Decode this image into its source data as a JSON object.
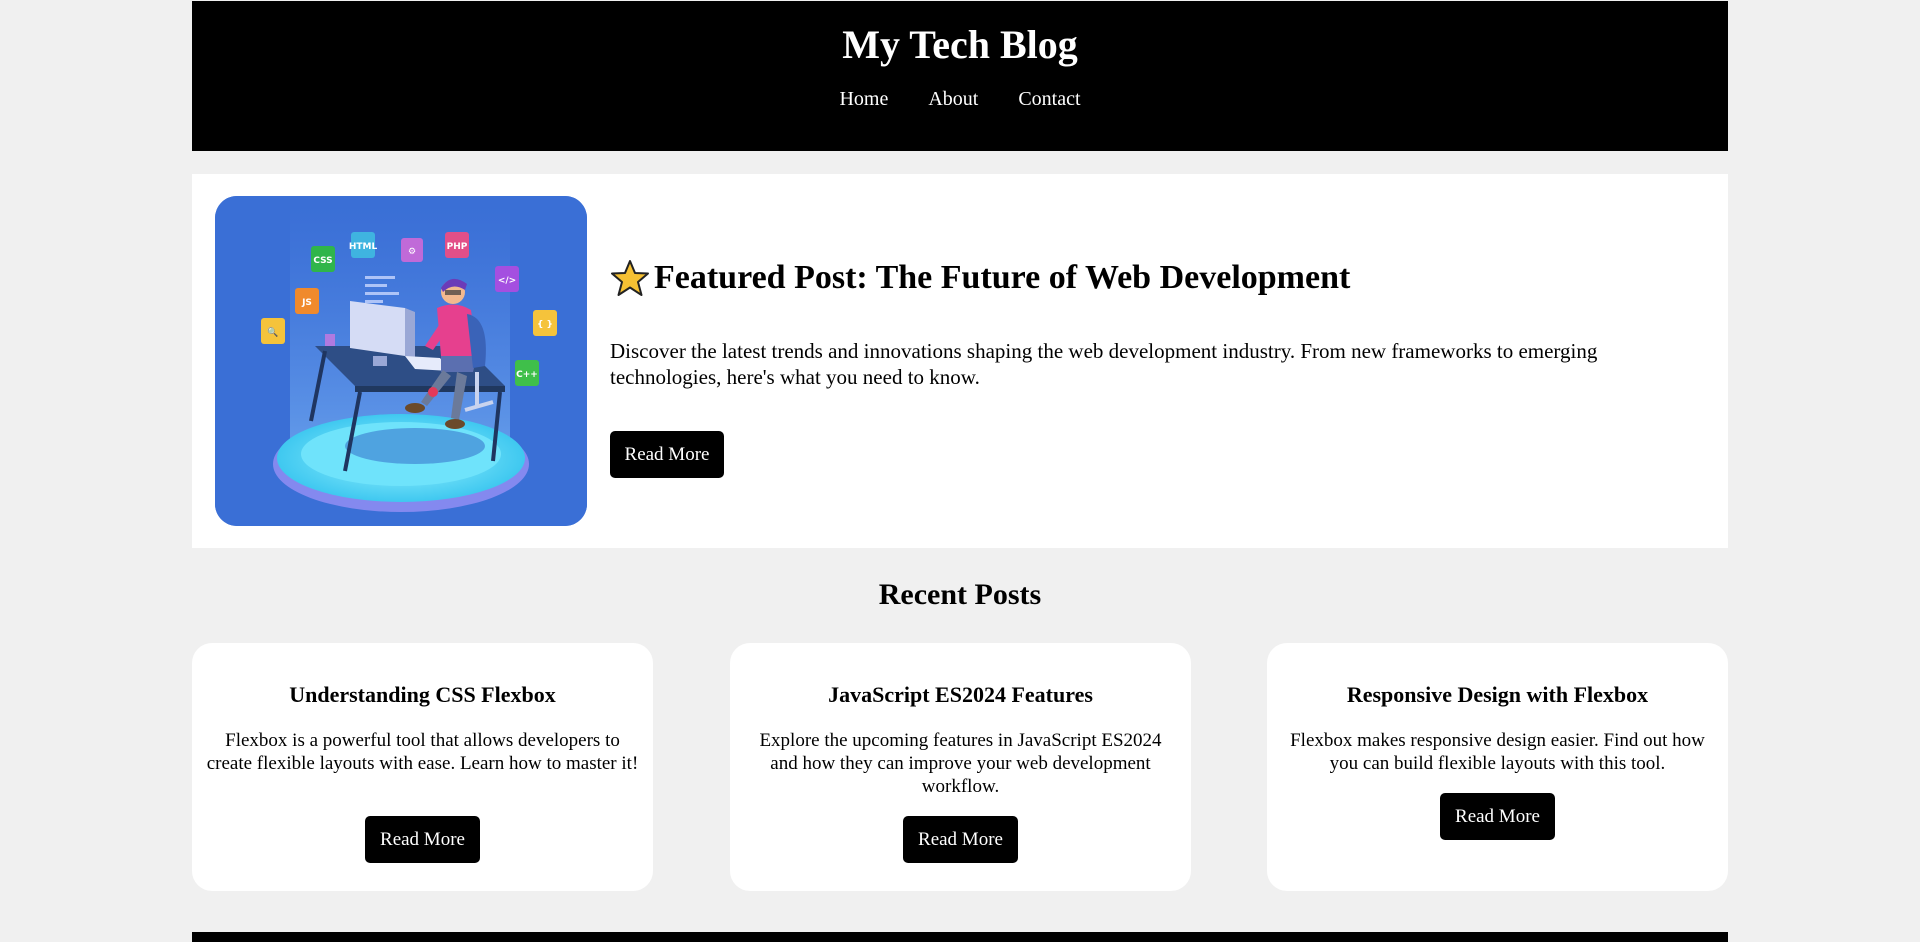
{
  "header": {
    "title": "My Tech Blog",
    "nav": [
      "Home",
      "About",
      "Contact"
    ]
  },
  "featured": {
    "image_icon": "developer-illustration",
    "star_icon": "star-icon",
    "title": "Featured Post: The Future of Web Development",
    "description": "Discover the latest trends and innovations shaping the web development industry. From new frameworks to emerging technologies, here's what you need to know.",
    "button": "Read More"
  },
  "recent": {
    "heading": "Recent Posts",
    "posts": [
      {
        "title": "Understanding CSS Flexbox",
        "excerpt": "Flexbox is a powerful tool that allows developers to create flexible layouts with ease. Learn how to master it!",
        "button": "Read More"
      },
      {
        "title": "JavaScript ES2024 Features",
        "excerpt": "Explore the upcoming features in JavaScript ES2024 and how they can improve your web development workflow.",
        "button": "Read More"
      },
      {
        "title": "Responsive Design with Flexbox",
        "excerpt": "Flexbox makes responsive design easier. Find out how you can build flexible layouts with this tool.",
        "button": "Read More"
      }
    ]
  },
  "colors": {
    "page_background": "#f0f0f0",
    "header_background": "#000000",
    "button_background": "#000000",
    "card_background": "#ffffff",
    "illustration_background": "#3a6fd6"
  }
}
